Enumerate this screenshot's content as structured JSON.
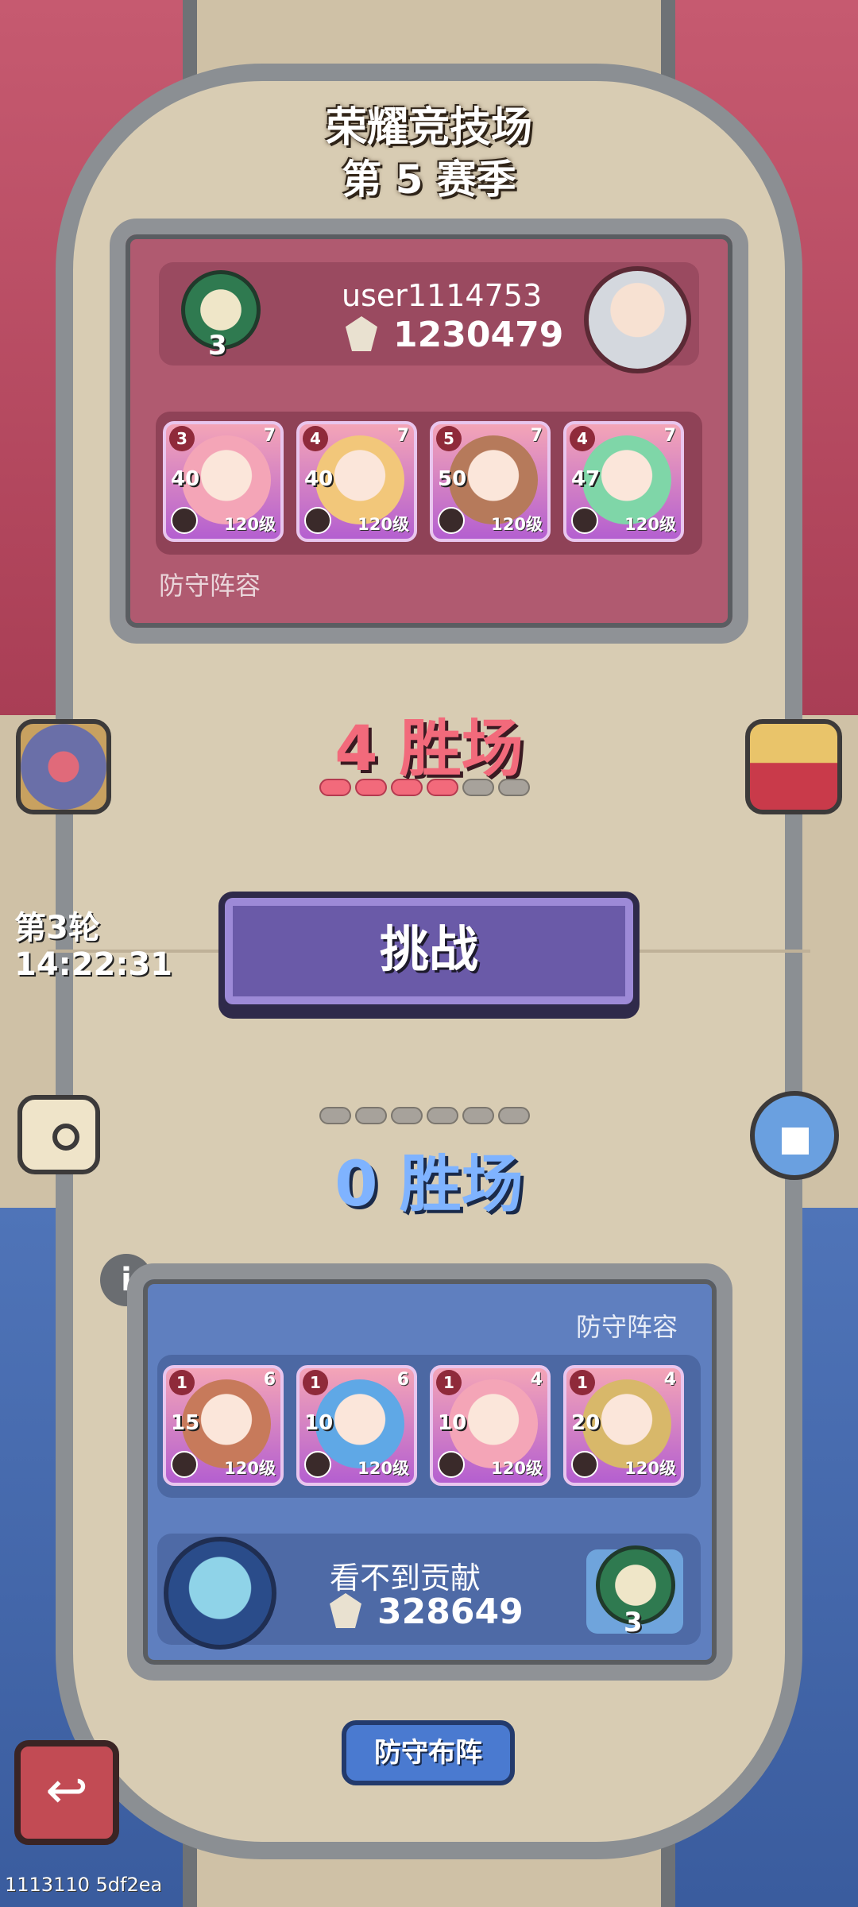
{
  "header": {
    "arena_name": "荣耀竞技场",
    "season": "第 5 赛季"
  },
  "opponent": {
    "name": "user1114753",
    "power": "1230479",
    "token_count": "3",
    "team_label": "防守阵容",
    "heroes": [
      {
        "rank": "3",
        "stars": "7",
        "level_num": "40",
        "level": "120级",
        "accent": "#f4a5b7"
      },
      {
        "rank": "4",
        "stars": "7",
        "level_num": "40",
        "level": "120级",
        "accent": "#f2c77a"
      },
      {
        "rank": "5",
        "stars": "7",
        "level_num": "50",
        "level": "120级",
        "accent": "#b67a5b"
      },
      {
        "rank": "4",
        "stars": "7",
        "level_num": "47",
        "level": "120级",
        "accent": "#7fd6a8"
      }
    ]
  },
  "battle": {
    "opponent_wins": "4 胜场",
    "opponent_win_dots": [
      true,
      true,
      true,
      true,
      false,
      false
    ],
    "challenge_label": "挑战",
    "round_label": "第3轮",
    "round_timer": "14:22:31",
    "own_win_dots": [
      false,
      false,
      false,
      false,
      false,
      false
    ],
    "own_wins": "0 胜场"
  },
  "player": {
    "name": "看不到贡献",
    "power": "328649",
    "token_count": "3",
    "team_label": "防守阵容",
    "heroes": [
      {
        "rank": "1",
        "stars": "6",
        "level_num": "15",
        "level": "120级",
        "accent": "#c77a5b"
      },
      {
        "rank": "1",
        "stars": "6",
        "level_num": "10",
        "level": "120级",
        "accent": "#5fa8e6"
      },
      {
        "rank": "1",
        "stars": "4",
        "level_num": "10",
        "level": "120级",
        "accent": "#f4a5b7"
      },
      {
        "rank": "1",
        "stars": "4",
        "level_num": "20",
        "level": "120级",
        "accent": "#d8b86a"
      }
    ]
  },
  "footer": {
    "defense_button": "防守布阵",
    "build_info": "1113110 5df2ea"
  },
  "icons": {
    "chest": "treasure-chest-icon",
    "gift": "gift-box-icon",
    "search": "magnifier-icon",
    "ranking": "podium-icon",
    "info": "info-icon",
    "back": "back-arrow-icon",
    "power": "crown-power-icon"
  }
}
